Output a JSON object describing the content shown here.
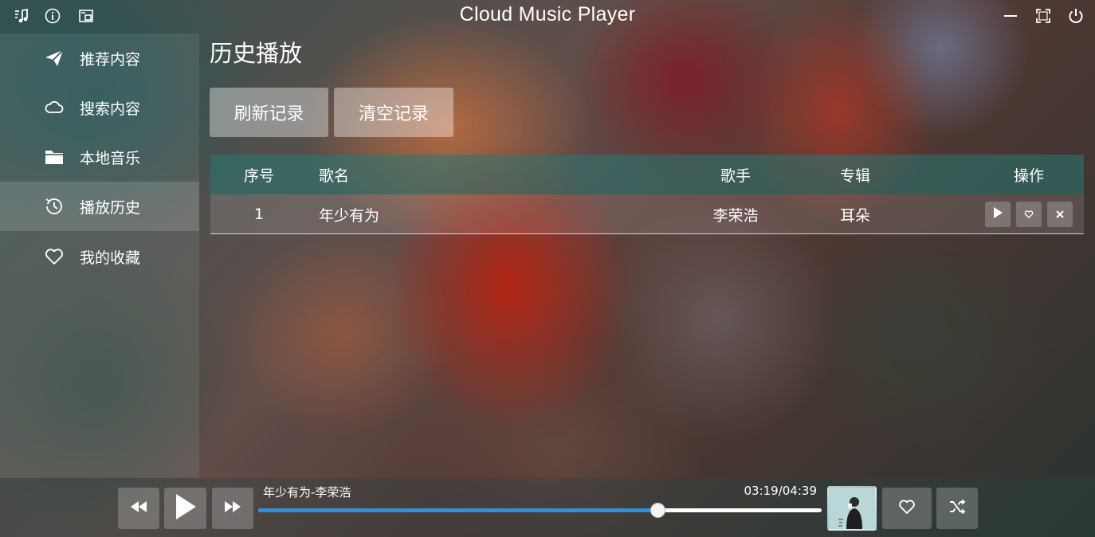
{
  "app": {
    "title": "Cloud Music Player"
  },
  "titlebar": {
    "left_icons": [
      "music-note-icon",
      "info-icon",
      "mini-mode-icon"
    ],
    "right_icons": [
      "minimize-icon",
      "fullscreen-icon",
      "power-icon"
    ]
  },
  "sidebar": {
    "items": [
      {
        "label": "推荐内容",
        "icon": "paper-plane-icon",
        "active": false
      },
      {
        "label": "搜索内容",
        "icon": "cloud-icon",
        "active": false
      },
      {
        "label": "本地音乐",
        "icon": "folder-icon",
        "active": false
      },
      {
        "label": "播放历史",
        "icon": "history-icon",
        "active": true
      },
      {
        "label": "我的收藏",
        "icon": "heart-icon",
        "active": false
      }
    ]
  },
  "main": {
    "page_title": "历史播放",
    "buttons": {
      "refresh": "刷新记录",
      "clear": "清空记录"
    },
    "table": {
      "headers": {
        "index": "序号",
        "name": "歌名",
        "artist": "歌手",
        "album": "专辑",
        "ops": "操作"
      },
      "rows": [
        {
          "index": "1",
          "name": "年少有为",
          "artist": "李荣浩",
          "album": "耳朵"
        }
      ],
      "row_actions": [
        "play-icon",
        "favorite-icon",
        "remove-icon"
      ]
    }
  },
  "player": {
    "now_playing": "年少有为-李荣浩",
    "time": "03:19/04:39",
    "progress": 0.71,
    "colors": {
      "progress": "#2f8fd8"
    },
    "controls": [
      "rewind-icon",
      "play-icon",
      "fast-forward-icon",
      "heart-icon",
      "shuffle-icon"
    ]
  }
}
